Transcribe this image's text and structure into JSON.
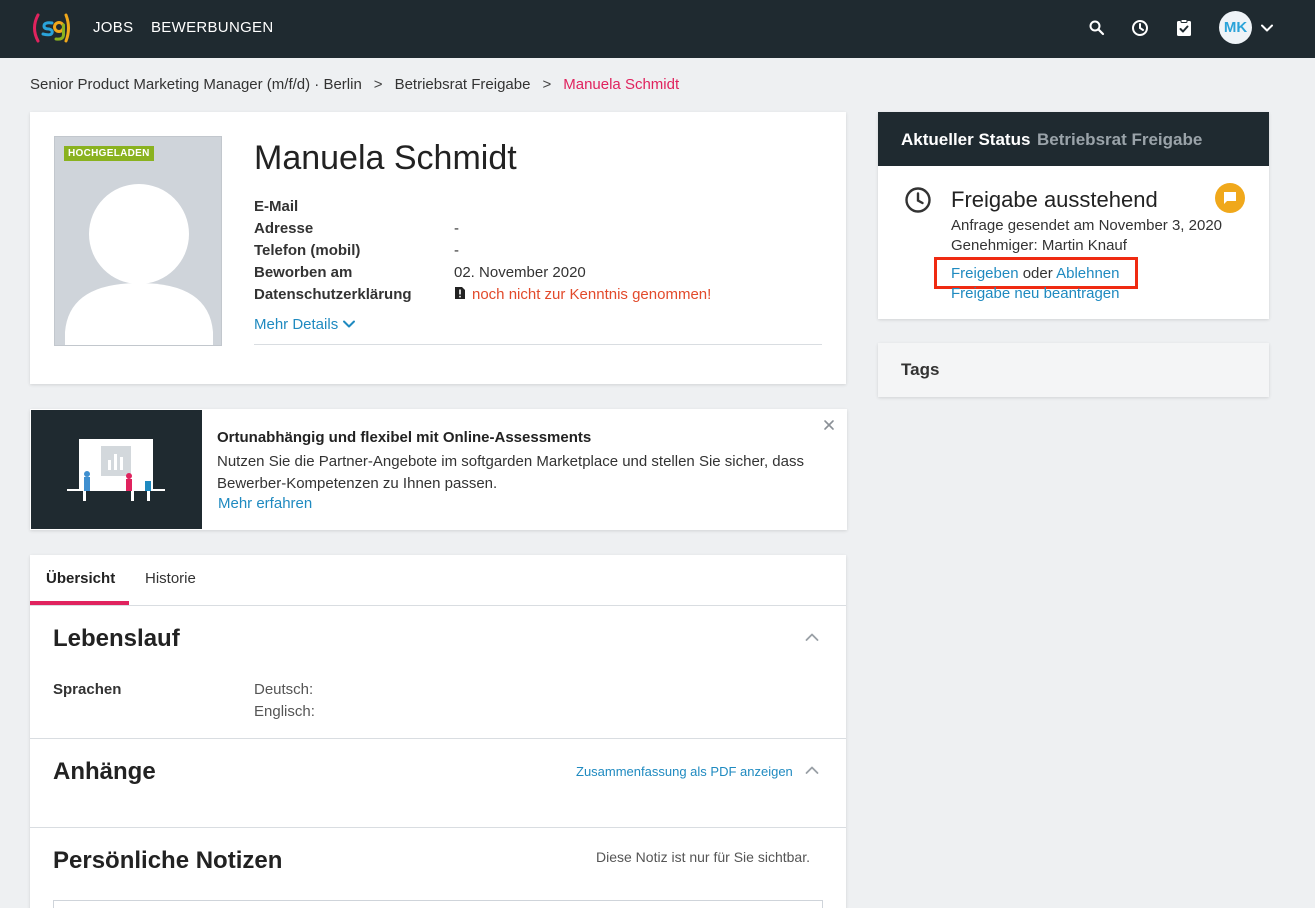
{
  "nav": {
    "items": [
      "JOBS",
      "BEWERBUNGEN"
    ],
    "avatar_initials": "MK"
  },
  "breadcrumb": {
    "job": "Senior Product Marketing Manager (m/f/d) · Berlin",
    "separator": ">",
    "step": "Betriebsrat Freigabe",
    "current": "Manuela Schmidt"
  },
  "profile": {
    "badge": "HOCHGELADEN",
    "name": "Manuela Schmidt",
    "fields": [
      {
        "label": "E-Mail",
        "value": ""
      },
      {
        "label": "Adresse",
        "value": "-"
      },
      {
        "label": "Telefon (mobil)",
        "value": "-"
      },
      {
        "label": "Beworben am",
        "value": "02. November 2020"
      },
      {
        "label": "Datenschutzerklärung",
        "value": "noch nicht zur Kenntnis genommen!"
      }
    ],
    "more_details": "Mehr Details"
  },
  "promo": {
    "title": "Ortunabhängig und flexibel mit Online-Assessments",
    "text": "Nutzen Sie die Partner-Angebote im softgarden Marketplace und stellen Sie sicher, dass Bewerber-Kompetenzen zu Ihnen passen.",
    "link": "Mehr erfahren"
  },
  "tabs": [
    "Übersicht",
    "Historie"
  ],
  "sections": {
    "lebenslauf": {
      "title": "Lebenslauf",
      "sprachen_label": "Sprachen",
      "languages": [
        "Deutsch:",
        "Englisch:"
      ]
    },
    "anhaenge": {
      "title": "Anhänge",
      "pdf_link": "Zusammenfassung als PDF anzeigen"
    },
    "notizen": {
      "title": "Persönliche Notizen",
      "hint": "Diese Notiz ist nur für Sie sichtbar."
    }
  },
  "status": {
    "label": "Aktueller Status",
    "value": "Betriebsrat Freigabe",
    "title": "Freigabe ausstehend",
    "sent": "Anfrage gesendet am November 3, 2020",
    "approver": "Genehmiger: Martin Knauf",
    "approve": "Freigeben",
    "or": "oder",
    "reject": "Ablehnen",
    "re_request": "Freigabe neu beantragen"
  },
  "tags": {
    "title": "Tags"
  },
  "colors": {
    "topbar": "#1f2a30",
    "accent_pink": "#e0235e",
    "link_blue": "#1f8ac0",
    "warning_red": "#e24a2b",
    "badge_green": "#8ab21f",
    "chat_orange": "#f0a81b",
    "highlight_red": "#ef2a11"
  },
  "icons": [
    "logo",
    "search-icon",
    "clock-icon",
    "task-icon",
    "chevron-down-icon",
    "warning-file-icon",
    "close-icon",
    "chevron-up-icon",
    "chat-icon"
  ]
}
